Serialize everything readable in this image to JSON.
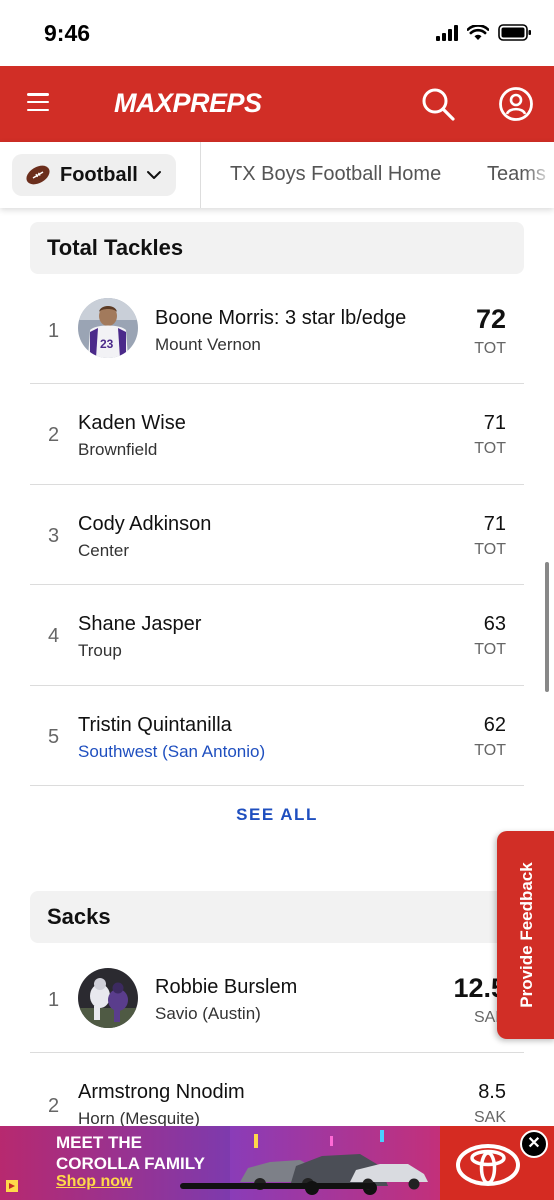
{
  "status_bar": {
    "time": "9:46"
  },
  "header": {
    "logo_text": "MAXPREPS",
    "brand_color": "#d12e26"
  },
  "subnav": {
    "sport": "Football",
    "links": [
      "TX Boys Football Home",
      "Teams"
    ]
  },
  "sections": [
    {
      "title": "Total Tackles",
      "rows": [
        {
          "rank": "1",
          "name": "Boone Morris: 3 star lb/edge",
          "school": "Mount Vernon",
          "value": "72",
          "unit": "TOT"
        },
        {
          "rank": "2",
          "name": "Kaden Wise",
          "school": "Brownfield",
          "value": "71",
          "unit": "TOT"
        },
        {
          "rank": "3",
          "name": "Cody Adkinson",
          "school": "Center",
          "value": "71",
          "unit": "TOT"
        },
        {
          "rank": "4",
          "name": "Shane Jasper",
          "school": "Troup",
          "value": "63",
          "unit": "TOT"
        },
        {
          "rank": "5",
          "name": "Tristin Quintanilla",
          "school": "Southwest (San Antonio)",
          "value": "62",
          "unit": "TOT"
        }
      ],
      "see_all": "SEE ALL"
    },
    {
      "title": "Sacks",
      "rows": [
        {
          "rank": "1",
          "name": "Robbie Burslem",
          "school": "Savio (Austin)",
          "value": "12.5",
          "unit": "SAK"
        },
        {
          "rank": "2",
          "name": "Armstrong Nnodim",
          "school": "Horn (Mesquite)",
          "value": "8.5",
          "unit": "SAK"
        }
      ]
    }
  ],
  "feedback": {
    "label": "Provide Feedback"
  },
  "ad": {
    "line1": "MEET THE",
    "line2": "COROLLA FAMILY",
    "cta": "Shop now",
    "close": "✕"
  }
}
